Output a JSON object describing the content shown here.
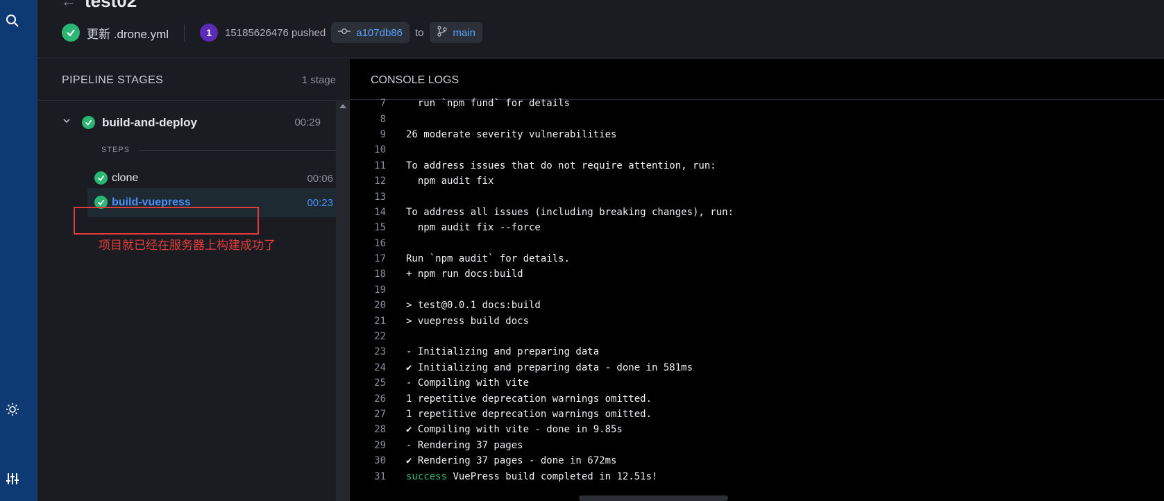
{
  "header": {
    "repo_title": "test02",
    "commit_message": "更新 .drone.yml",
    "avatar_label": "1",
    "pushed_text": "15185626476 pushed",
    "commit_hash": "a107db86",
    "to_text": "to",
    "branch": "main"
  },
  "stages_panel": {
    "title": "PIPELINE STAGES",
    "count": "1 stage",
    "stage": {
      "name": "build-and-deploy",
      "duration": "00:29"
    },
    "steps_label": "STEPS",
    "steps": [
      {
        "name": "clone",
        "duration": "00:06"
      },
      {
        "name": "build-vuepress",
        "duration": "00:23"
      }
    ],
    "annotation": "项目就已经在服务器上构建成功了"
  },
  "console": {
    "title": "CONSOLE LOGS",
    "lines": [
      {
        "n": "7",
        "t": "  run `npm fund` for details"
      },
      {
        "n": "8",
        "t": ""
      },
      {
        "n": "9",
        "t": "26 moderate severity vulnerabilities"
      },
      {
        "n": "10",
        "t": ""
      },
      {
        "n": "11",
        "t": "To address issues that do not require attention, run:"
      },
      {
        "n": "12",
        "t": "  npm audit fix"
      },
      {
        "n": "13",
        "t": ""
      },
      {
        "n": "14",
        "t": "To address all issues (including breaking changes), run:"
      },
      {
        "n": "15",
        "t": "  npm audit fix --force"
      },
      {
        "n": "16",
        "t": ""
      },
      {
        "n": "17",
        "t": "Run `npm audit` for details."
      },
      {
        "n": "18",
        "t": "+ npm run docs:build"
      },
      {
        "n": "19",
        "t": ""
      },
      {
        "n": "20",
        "t": "> test@0.0.1 docs:build"
      },
      {
        "n": "21",
        "t": "> vuepress build docs"
      },
      {
        "n": "22",
        "t": ""
      },
      {
        "n": "23",
        "t": "- Initializing and preparing data"
      },
      {
        "n": "24",
        "t": "✔ Initializing and preparing data - done in 581ms"
      },
      {
        "n": "25",
        "t": "- Compiling with vite"
      },
      {
        "n": "26",
        "t": "1 repetitive deprecation warnings omitted."
      },
      {
        "n": "27",
        "t": "1 repetitive deprecation warnings omitted."
      },
      {
        "n": "28",
        "t": "✔ Compiling with vite - done in 9.85s"
      },
      {
        "n": "29",
        "t": "- Rendering 37 pages"
      },
      {
        "n": "30",
        "t": "✔ Rendering 37 pages - done in 672ms"
      }
    ],
    "last_line": {
      "n": "31",
      "prefix": "success",
      "t": " VuePress build completed in 12.51s!"
    }
  },
  "icons": [
    "search-icon",
    "sun-icon",
    "sliders-icon",
    "back-arrow-icon",
    "check-icon",
    "commit-icon",
    "branch-icon",
    "chevron-down-icon"
  ],
  "colors": {
    "rail": "#0e3a73",
    "success": "#2bb673",
    "link": "#4b8fff",
    "annotation": "#e23b3b",
    "avatar": "#5b2bb7"
  }
}
